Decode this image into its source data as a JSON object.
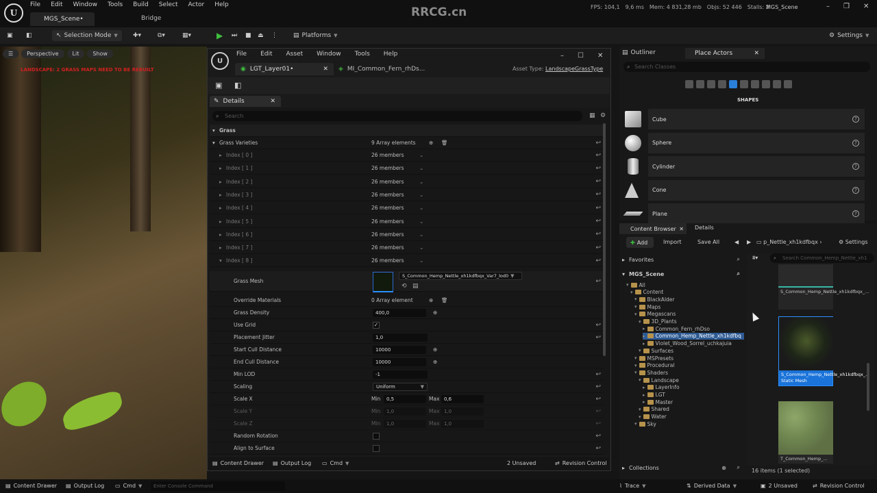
{
  "menu": [
    "File",
    "Edit",
    "Window",
    "Tools",
    "Build",
    "Select",
    "Actor",
    "Help"
  ],
  "tabs": {
    "scene": "MGS_Scene•",
    "bridge": "Bridge"
  },
  "watermark": "RRCG.cn",
  "stats": {
    "fps": "FPS: 104,1",
    "ms": "9,6 ms",
    "mem": "Mem: 4 831,28 mb",
    "objs": "Objs: 52 446",
    "stalls": "Stalls: 2"
  },
  "project_name": "MGS_Scene",
  "toolbar": {
    "selection_mode": "Selection Mode",
    "platforms": "Platforms",
    "settings": "Settings"
  },
  "viewport": {
    "perspective": "Perspective",
    "lit": "Lit",
    "show": "Show",
    "warning": "LANDSCAPE: 2 GRASS MAPS NEED TO BE REBUILT"
  },
  "editor": {
    "menu": [
      "File",
      "Edit",
      "Asset",
      "Window",
      "Tools",
      "Help"
    ],
    "tab1": "LGT_Layer01•",
    "tab2": "MI_Common_Fern_rhDs...",
    "asset_type_label": "Asset Type:",
    "asset_type": "LandscapeGrassType",
    "details_tab": "Details",
    "search_placeholder": "Search",
    "section": "Grass",
    "grass_varieties": {
      "label": "Grass Varieties",
      "value": "9 Array elements"
    },
    "indices": [
      {
        "label": "Index [ 0 ]",
        "value": "26 members"
      },
      {
        "label": "Index [ 1 ]",
        "value": "26 members"
      },
      {
        "label": "Index [ 2 ]",
        "value": "26 members"
      },
      {
        "label": "Index [ 3 ]",
        "value": "26 members"
      },
      {
        "label": "Index [ 4 ]",
        "value": "26 members"
      },
      {
        "label": "Index [ 5 ]",
        "value": "26 members"
      },
      {
        "label": "Index [ 6 ]",
        "value": "26 members"
      },
      {
        "label": "Index [ 7 ]",
        "value": "26 members"
      },
      {
        "label": "Index [ 8 ]",
        "value": "26 members"
      }
    ],
    "props": {
      "grass_mesh": {
        "label": "Grass Mesh",
        "value": "S_Common_Hemp_Nettle_xh1kdfbqx_Var7_lod0"
      },
      "override_materials": {
        "label": "Override Materials",
        "value": "0 Array element"
      },
      "grass_density": {
        "label": "Grass Density",
        "value": "400,0"
      },
      "use_grid": {
        "label": "Use Grid",
        "value": "✓"
      },
      "placement_jitter": {
        "label": "Placement Jitter",
        "value": "1,0"
      },
      "start_cull": {
        "label": "Start Cull Distance",
        "value": "10000"
      },
      "end_cull": {
        "label": "End Cull Distance",
        "value": "10000"
      },
      "min_lod": {
        "label": "Min LOD",
        "value": "-1"
      },
      "scaling": {
        "label": "Scaling",
        "value": "Uniform"
      },
      "scale_x": {
        "label": "Scale X",
        "min_label": "Min",
        "min": "0,5",
        "max_label": "Max",
        "max": "0,6"
      },
      "scale_y": {
        "label": "Scale Y",
        "min_label": "Min",
        "min": "1,0",
        "max_label": "Max",
        "max": "1,0"
      },
      "scale_z": {
        "label": "Scale Z",
        "min_label": "Min",
        "min": "1,0",
        "max_label": "Max",
        "max": "1,0"
      },
      "random_rotation": {
        "label": "Random Rotation"
      },
      "align_surface": {
        "label": "Align to Surface"
      }
    },
    "status": {
      "content_drawer": "Content Drawer",
      "output_log": "Output Log",
      "cmd": "Cmd",
      "unsaved": "2 Unsaved",
      "revision": "Revision Control"
    }
  },
  "outliner": {
    "tab": "Outliner",
    "place_actors": "Place Actors",
    "search_placeholder": "Search Classes",
    "shapes_title": "SHAPES",
    "shapes": [
      "Cube",
      "Sphere",
      "Cylinder",
      "Cone",
      "Plane"
    ]
  },
  "content_browser": {
    "tab": "Content Browser",
    "details": "Details",
    "add": "Add",
    "import": "Import",
    "save_all": "Save All",
    "path": "p_Nettle_xh1kdfbqx",
    "settings": "Settings",
    "favorites": "Favorites",
    "scene": "MGS_Scene",
    "tree": [
      {
        "label": "All",
        "depth": 0
      },
      {
        "label": "Content",
        "depth": 1
      },
      {
        "label": "BlackAlder",
        "depth": 2
      },
      {
        "label": "Maps",
        "depth": 2
      },
      {
        "label": "Megascans",
        "depth": 2
      },
      {
        "label": "3D_Plants",
        "depth": 3
      },
      {
        "label": "Common_Fern_rhDso",
        "depth": 4
      },
      {
        "label": "Common_Hemp_Nettle_xh1kdfbq",
        "depth": 4,
        "selected": true
      },
      {
        "label": "Violet_Wood_Sorrel_uchkajuia",
        "depth": 4
      },
      {
        "label": "Surfaces",
        "depth": 3
      },
      {
        "label": "MSPresets",
        "depth": 2
      },
      {
        "label": "Procedural",
        "depth": 2
      },
      {
        "label": "Shaders",
        "depth": 2
      },
      {
        "label": "Landscape",
        "depth": 3
      },
      {
        "label": "LayerInfo",
        "depth": 4
      },
      {
        "label": "LGT",
        "depth": 4
      },
      {
        "label": "Master",
        "depth": 4
      },
      {
        "label": "Shared",
        "depth": 3
      },
      {
        "label": "Water",
        "depth": 3
      },
      {
        "label": "Sky",
        "depth": 2
      }
    ],
    "search_placeholder": "Search Common_Hemp_Nettle_xh1",
    "tiles": [
      "S_Common_Hemp_Nettle_xh1kdfbqx_...",
      "S_Common_Hemp_Nettle_xh1kdfbqx_...",
      "T_Common_Hemp_..."
    ],
    "tile_type": "Static Mesh",
    "collections": "Collections",
    "items": "16 items (1 selected)"
  },
  "bottom": {
    "content_drawer": "Content Drawer",
    "output_log": "Output Log",
    "cmd": "Cmd",
    "console_placeholder": "Enter Console Command",
    "trace": "Trace",
    "derived": "Derived Data",
    "unsaved": "2 Unsaved",
    "revision": "Revision Control"
  }
}
